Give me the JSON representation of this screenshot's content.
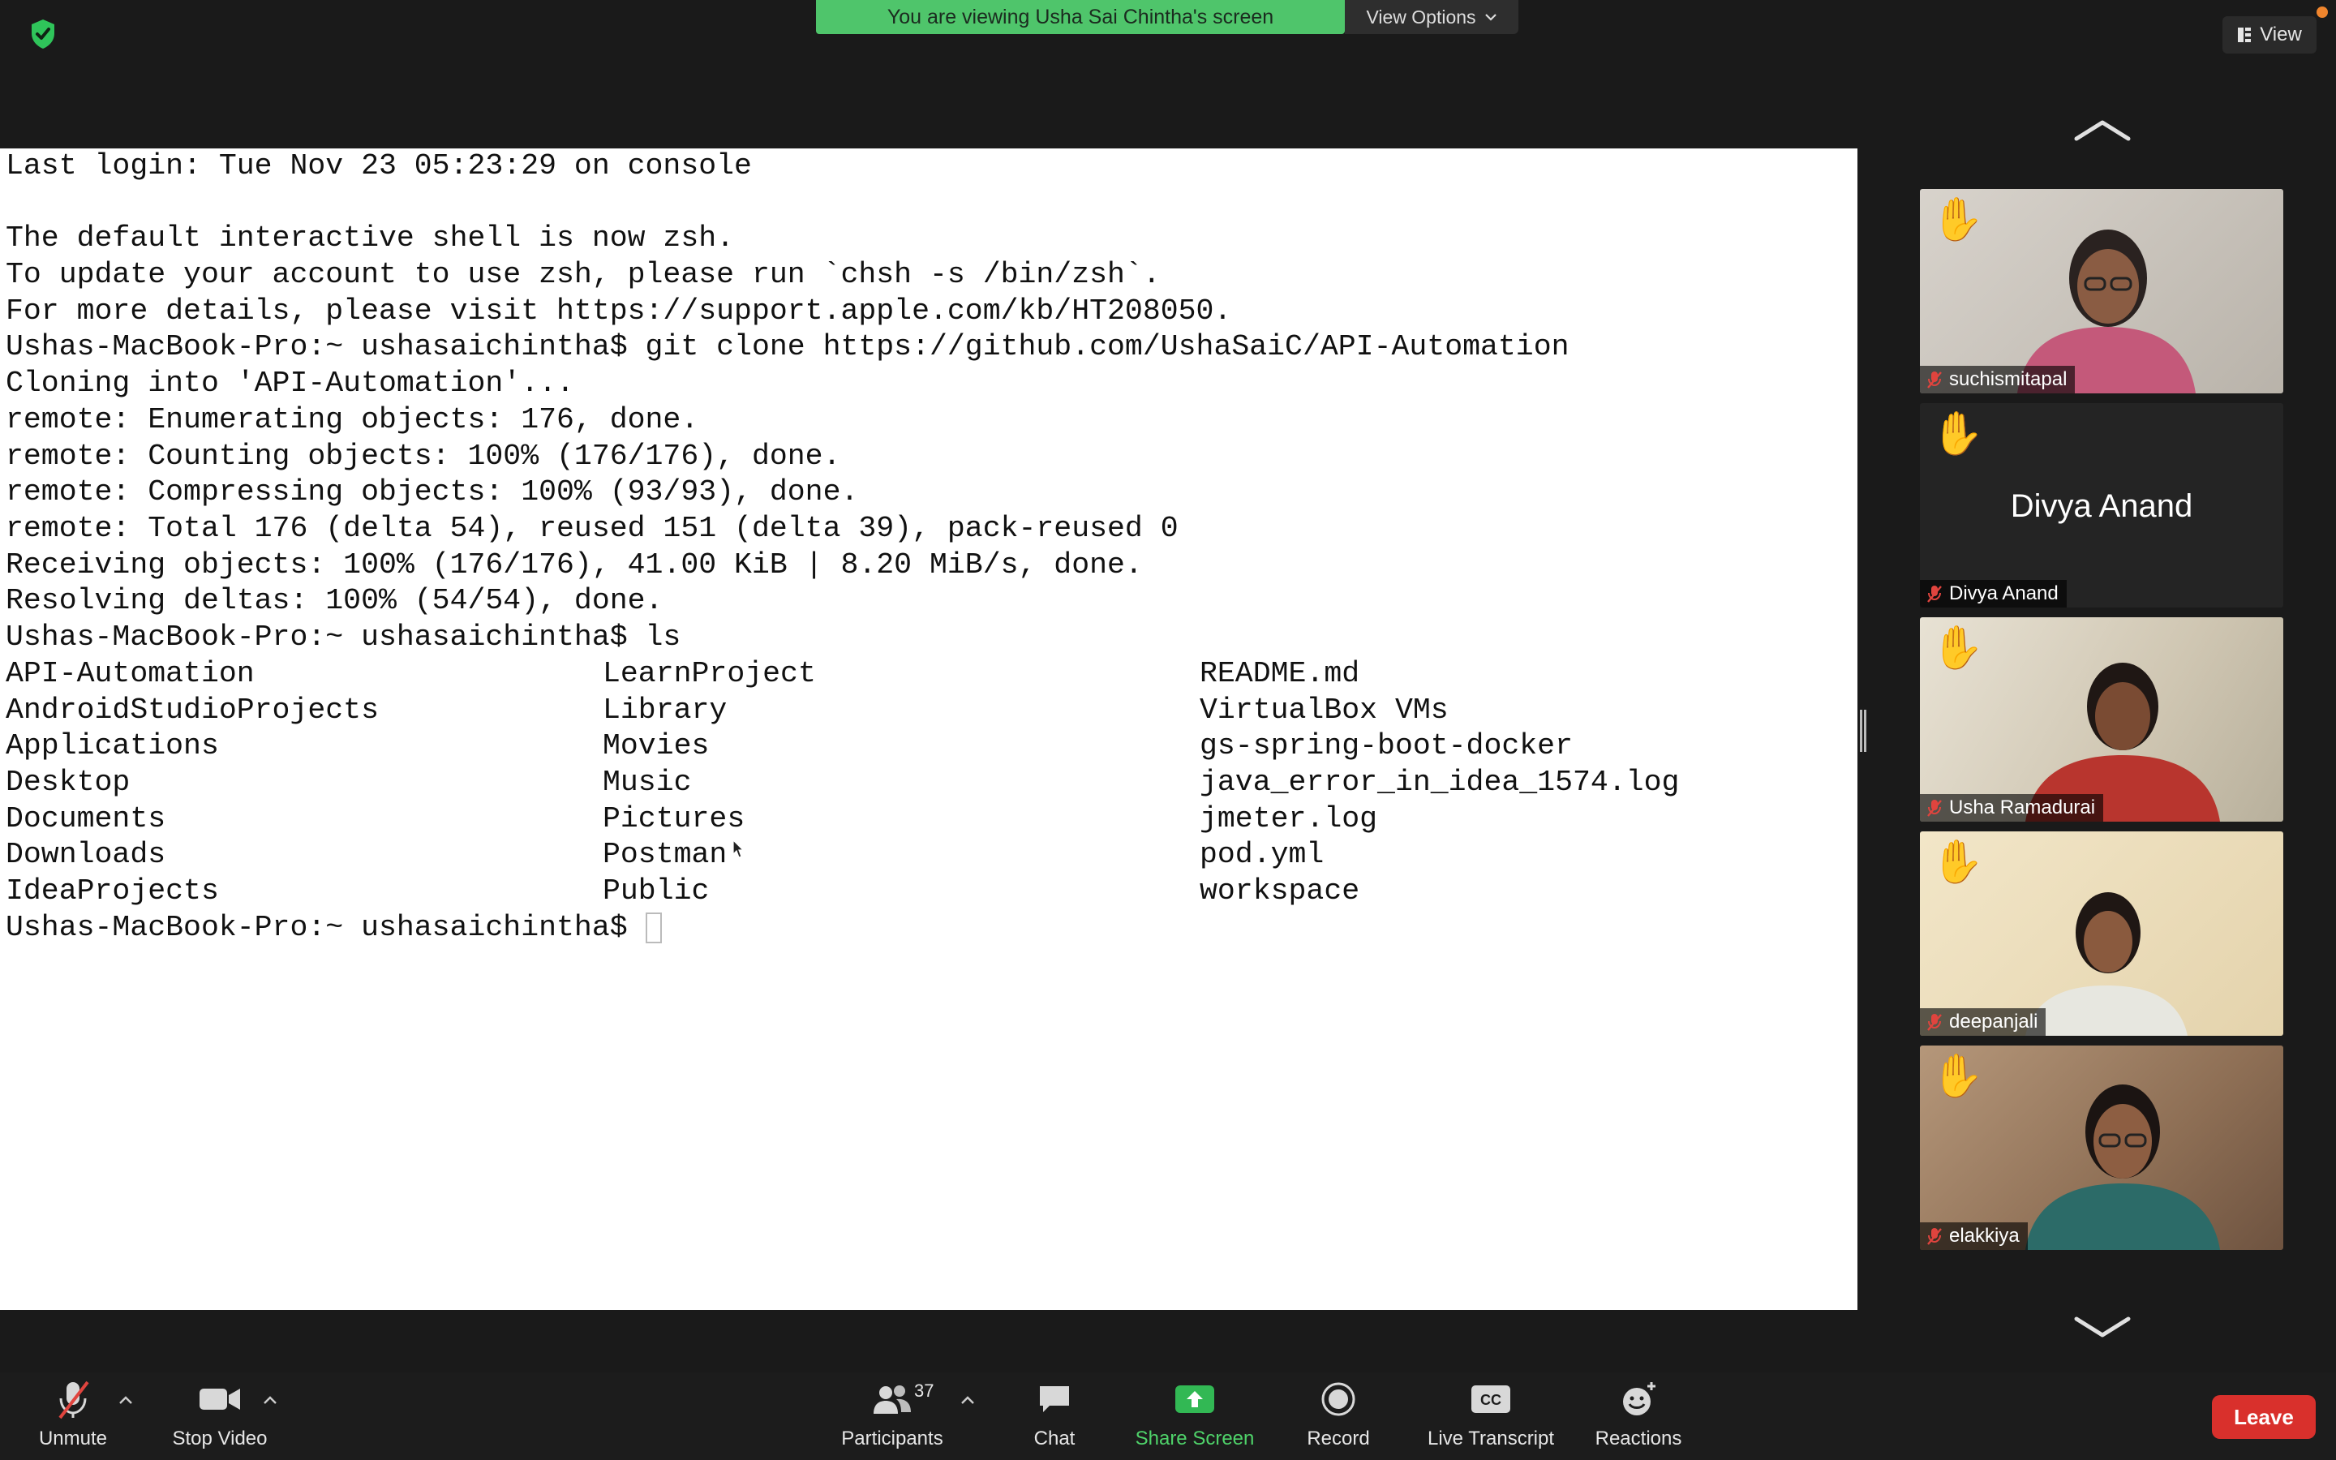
{
  "top_bar": {
    "viewing_banner": "You are viewing Usha Sai Chintha's screen",
    "view_options": "View Options",
    "view_button": "View"
  },
  "terminal": {
    "lines": [
      "Last login: Tue Nov 23 05:23:29 on console",
      "",
      "The default interactive shell is now zsh.",
      "To update your account to use zsh, please run `chsh -s /bin/zsh`.",
      "For more details, please visit https://support.apple.com/kb/HT208050.",
      "Ushas-MacBook-Pro:~ ushasaichintha$ git clone https://github.com/UshaSaiC/API-Automation",
      "Cloning into 'API-Automation'...",
      "remote: Enumerating objects: 176, done.",
      "remote: Counting objects: 100% (176/176), done.",
      "remote: Compressing objects: 100% (93/93), done.",
      "remote: Total 176 (delta 54), reused 151 (delta 39), pack-reused 0",
      "Receiving objects: 100% (176/176), 41.00 KiB | 8.20 MiB/s, done.",
      "Resolving deltas: 100% (54/54), done.",
      "Ushas-MacBook-Pro:~ ushasaichintha$ ls"
    ],
    "ls_columns": [
      [
        "API-Automation",
        "AndroidStudioProjects",
        "Applications",
        "Desktop",
        "Documents",
        "Downloads",
        "IdeaProjects"
      ],
      [
        "LearnProject",
        "Library",
        "Movies",
        "Music",
        "Pictures",
        "Postman",
        "Public"
      ],
      [
        "README.md",
        "VirtualBox VMs",
        "gs-spring-boot-docker",
        "java_error_in_idea_1574.log",
        "jmeter.log",
        "pod.yml",
        "workspace"
      ]
    ],
    "final_prompt": "Ushas-MacBook-Pro:~ ushasaichintha$"
  },
  "participants": [
    {
      "name": "suchismitapal",
      "hand_raised": true,
      "video": true
    },
    {
      "name": "Divya Anand",
      "display_name": "Divya Anand",
      "hand_raised": true,
      "video": false
    },
    {
      "name": "Usha Ramadurai",
      "hand_raised": true,
      "video": true
    },
    {
      "name": "deepanjali",
      "hand_raised": true,
      "video": true
    },
    {
      "name": "elakkiya",
      "hand_raised": true,
      "video": true
    }
  ],
  "toolbar": {
    "unmute": "Unmute",
    "stop_video": "Stop Video",
    "participants": "Participants",
    "participants_count": "37",
    "chat": "Chat",
    "share_screen": "Share Screen",
    "record": "Record",
    "live_transcript": "Live Transcript",
    "reactions": "Reactions",
    "leave": "Leave"
  },
  "colors": {
    "banner_green": "#4fc56b",
    "share_green": "#4fd36a",
    "leave_red": "#d9302c",
    "muted_red": "#e0443e"
  }
}
